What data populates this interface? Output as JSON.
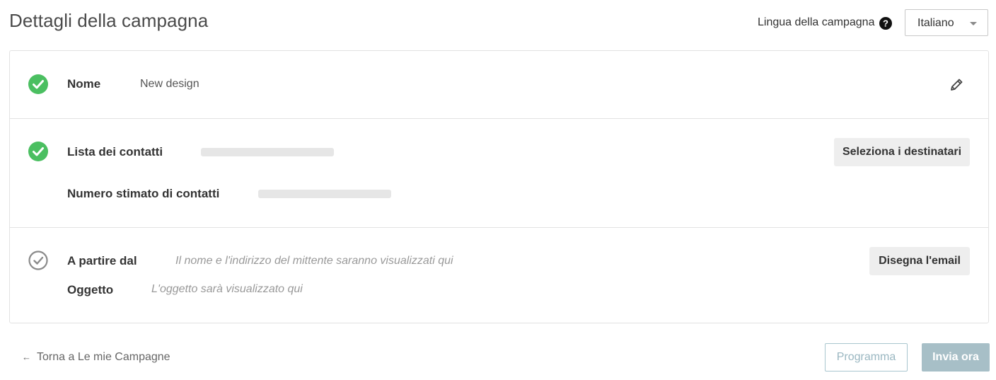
{
  "header": {
    "title": "Dettagli della campagna",
    "language_label": "Lingua della campagna",
    "language_selected": "Italiano"
  },
  "sections": {
    "name": {
      "label": "Nome",
      "value": "New design",
      "status": "complete"
    },
    "contacts": {
      "list_label": "Lista dei contatti",
      "estimate_label": "Numero stimato di contatti",
      "button_label": "Seleziona i destinatari",
      "status": "complete"
    },
    "sender": {
      "from_label": "A partire dal",
      "from_hint": "Il nome e l'indirizzo del mittente saranno visualizzati qui",
      "subject_label": "Oggetto",
      "subject_hint": "L'oggetto sarà visualizzato qui",
      "button_label": "Disegna l'email",
      "status": "incomplete"
    }
  },
  "footer": {
    "back_arrow": "←",
    "back_label": "Torna a Le mie Campagne",
    "schedule_label": "Programma",
    "send_label": "Invia ora"
  },
  "colors": {
    "success": "#4bbf61",
    "neutral_check": "#8a8a8a",
    "primary_disabled": "#a7bfc7"
  },
  "icons": [
    "help-icon",
    "chevron-down-icon",
    "check-circle-icon",
    "pencil-icon",
    "arrow-left-icon"
  ]
}
